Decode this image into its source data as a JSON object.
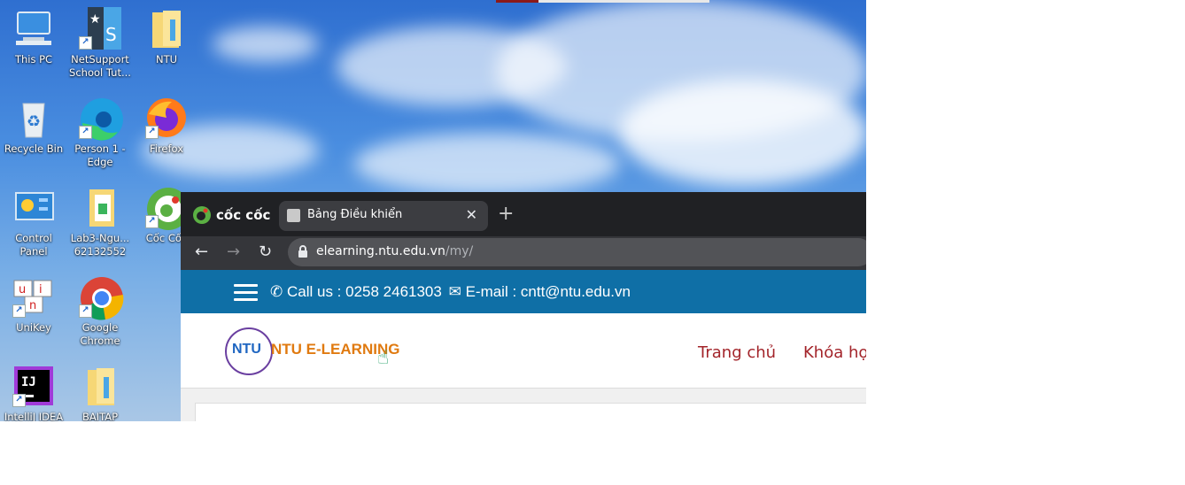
{
  "desktop": {
    "icons": [
      {
        "label": "This PC",
        "icon": "this-pc-icon"
      },
      {
        "label": "NetSupport School Tut...",
        "icon": "netsupport-icon"
      },
      {
        "label": "NTU",
        "icon": "folder-icon"
      },
      {
        "label": "Recycle Bin",
        "icon": "recycle-bin-icon"
      },
      {
        "label": "Person 1 - Edge",
        "icon": "edge-icon"
      },
      {
        "label": "Firefox",
        "icon": "firefox-icon"
      },
      {
        "label": "Control Panel",
        "icon": "control-panel-icon"
      },
      {
        "label": "Lab3-Ngu... 62132552",
        "icon": "document-folder-icon"
      },
      {
        "label": "Cốc Cốc",
        "icon": "coccoc-icon"
      },
      {
        "label": "UniKey",
        "icon": "unikey-icon"
      },
      {
        "label": "Google Chrome",
        "icon": "chrome-icon"
      },
      {
        "label": "IntelliJ IDEA",
        "icon": "intellij-icon"
      },
      {
        "label": "BAITAP",
        "icon": "folder-icon"
      }
    ]
  },
  "browser": {
    "brand": "cốc cốc",
    "tab_title": "Bảng Điều khiển",
    "close_symbol": "✕",
    "new_tab_symbol": "+",
    "back_symbol": "←",
    "forward_symbol": "→",
    "reload_symbol": "↻",
    "url_host": "elearning.ntu.edu.vn",
    "url_path": "/my/"
  },
  "page": {
    "call_label": "Call us : 0258 2461303",
    "email_label": "E-mail : cntt@ntu.edu.vn",
    "logo_text": "NTU",
    "brand_text": "NTU E-LEARNING",
    "menu": [
      "Trang chủ",
      "Khóa học"
    ],
    "colors": {
      "bar": "#0f6fa6",
      "menu": "#a3242a",
      "brand": "#e07a10"
    }
  }
}
